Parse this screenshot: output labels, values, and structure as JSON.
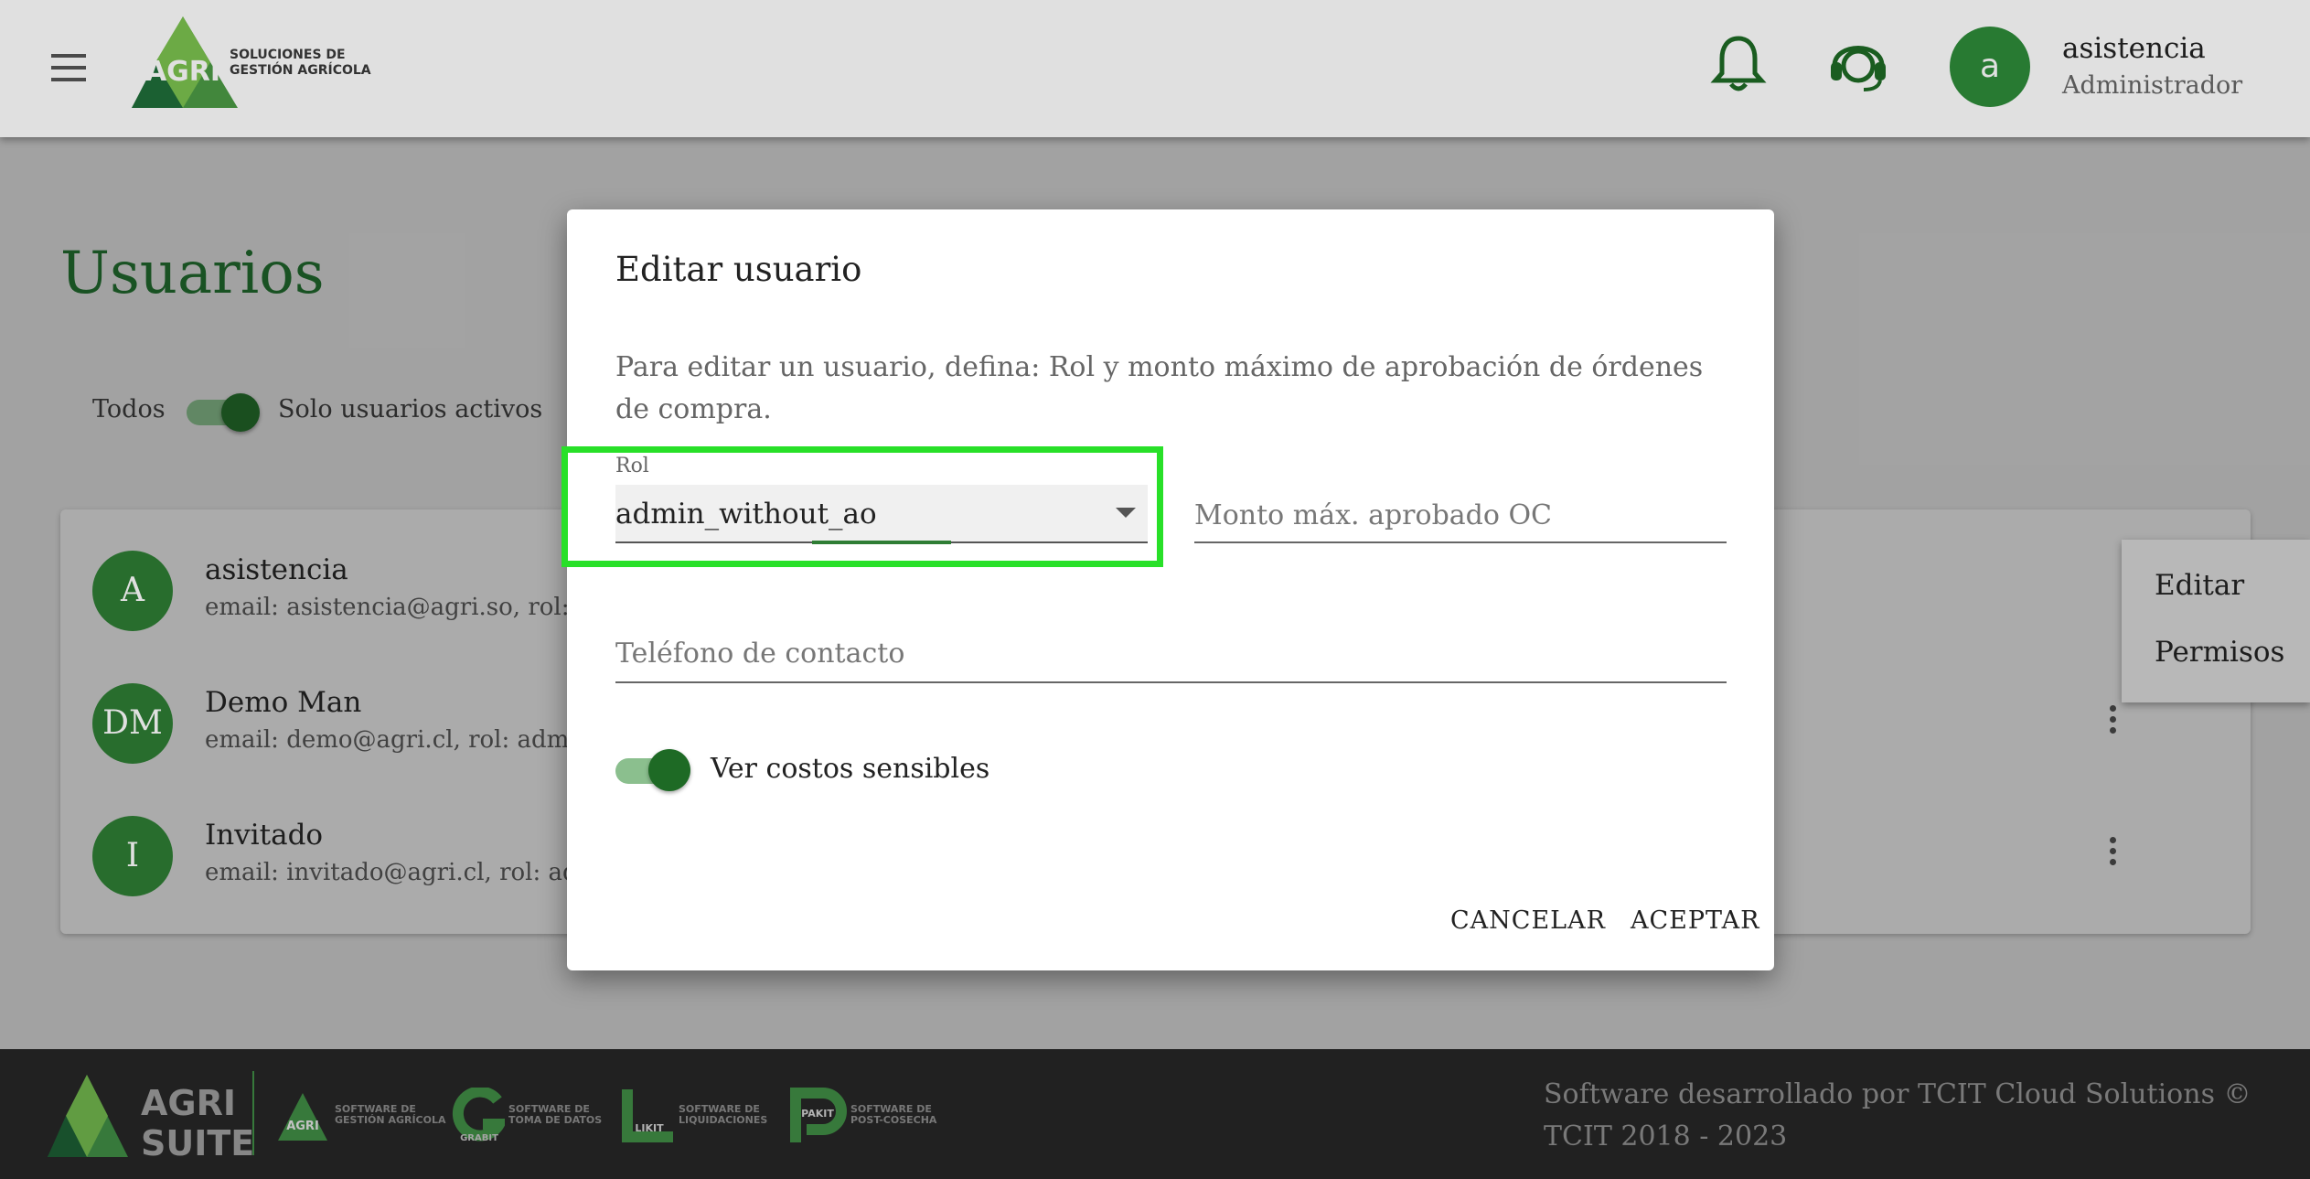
{
  "header": {
    "logo_text": "AGRI",
    "logo_tagline": [
      "SOLUCIONES DE",
      "GESTIÓN AGRÍCOLA"
    ],
    "user_initial": "a",
    "user_name": "asistencia",
    "user_role": "Administrador"
  },
  "page": {
    "title": "Usuarios",
    "filter_all": "Todos",
    "filter_active": "Solo usuarios activos"
  },
  "users": [
    {
      "initials": "A",
      "name": "asistencia",
      "detail": "email: asistencia@agri.so, rol: ad"
    },
    {
      "initials": "DM",
      "name": "Demo Man",
      "detail": "email: demo@agri.cl, rol: admin"
    },
    {
      "initials": "I",
      "name": "Invitado",
      "detail": "email: invitado@agri.cl, rol: adm"
    }
  ],
  "context_menu": {
    "edit": "Editar",
    "permissions": "Permisos"
  },
  "dialog": {
    "title": "Editar usuario",
    "description": "Para editar un usuario, defina: Rol y monto máximo de aprobación de órdenes de compra.",
    "rol_label": "Rol",
    "rol_value": "admin_without_ao",
    "monto_placeholder": "Monto máx. aprobado OC",
    "telefono_placeholder": "Teléfono de contacto",
    "switch_label": "Ver costos sensibles",
    "switch_on": true,
    "cancel": "CANCELAR",
    "accept": "ACEPTAR"
  },
  "footer": {
    "brand": [
      "AGRI",
      "SUITE"
    ],
    "products": [
      {
        "name": "AGRI",
        "caption": [
          "SOFTWARE DE",
          "GESTIÓN AGRÍCOLA"
        ]
      },
      {
        "name": "GRABIT",
        "caption": [
          "SOFTWARE DE",
          "TOMA DE DATOS"
        ]
      },
      {
        "name": "LIKIT",
        "caption": [
          "SOFTWARE DE",
          "LIQUIDACIONES"
        ]
      },
      {
        "name": "PAKIT",
        "caption": [
          "SOFTWARE DE",
          "POST-COSECHA"
        ]
      }
    ],
    "credits": "Software desarrollado por TCIT Cloud Solutions © TCIT 2018 - 2023"
  },
  "colors": {
    "primary_green": "#2e7d34",
    "highlight": "#28e028"
  }
}
